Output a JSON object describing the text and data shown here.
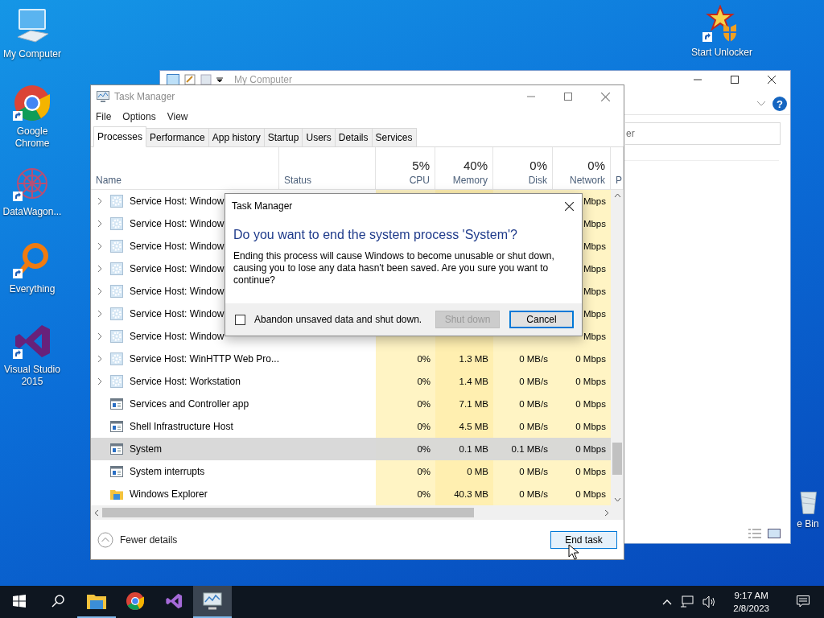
{
  "desktop_icons": [
    {
      "label": "My Computer",
      "kind": "computer",
      "shortcut": false
    },
    {
      "label": "Google Chrome",
      "kind": "chrome",
      "shortcut": true
    },
    {
      "label": "DataWagon...",
      "kind": "mandala",
      "shortcut": true
    },
    {
      "label": "Everything",
      "kind": "magnifier",
      "shortcut": true
    },
    {
      "label": "Visual Studio 2015",
      "kind": "vs",
      "shortcut": true
    },
    {
      "label": "Start Unlocker",
      "kind": "wand",
      "shortcut": true
    },
    {
      "label": "e Bin",
      "kind": "bin",
      "shortcut": false
    }
  ],
  "explorer": {
    "title": "My Computer",
    "search_text": "er",
    "help": "?"
  },
  "task_manager": {
    "title": "Task Manager",
    "menu": [
      "File",
      "Options",
      "View"
    ],
    "tabs": [
      {
        "label": "Processes",
        "selected": true
      },
      {
        "label": "Performance",
        "selected": false
      },
      {
        "label": "App history",
        "selected": false
      },
      {
        "label": "Startup",
        "selected": false
      },
      {
        "label": "Users",
        "selected": false
      },
      {
        "label": "Details",
        "selected": false
      },
      {
        "label": "Services",
        "selected": false
      }
    ],
    "columns": [
      {
        "label": "Name"
      },
      {
        "label": "Status"
      },
      {
        "label": "CPU",
        "percent": "5%"
      },
      {
        "label": "Memory",
        "percent": "40%"
      },
      {
        "label": "Disk",
        "percent": "0%"
      },
      {
        "label": "Network",
        "percent": "0%"
      },
      {
        "label": "P"
      }
    ],
    "rows": [
      {
        "name": "Service Host: Window",
        "kind": "gear",
        "expandable": true,
        "selected": false,
        "network": "Mbps"
      },
      {
        "name": "Service Host: Window",
        "kind": "gear",
        "expandable": true,
        "selected": false,
        "network": "Mbps"
      },
      {
        "name": "Service Host: Window",
        "kind": "gear",
        "expandable": true,
        "selected": false,
        "network": "Mbps"
      },
      {
        "name": "Service Host: Window",
        "kind": "gear",
        "expandable": true,
        "selected": false,
        "network": "Mbps"
      },
      {
        "name": "Service Host: Window",
        "kind": "gear",
        "expandable": true,
        "selected": false,
        "network": "Mbps"
      },
      {
        "name": "Service Host: Window",
        "kind": "gear",
        "expandable": true,
        "selected": false,
        "network": "Mbps"
      },
      {
        "name": "Service Host: Window",
        "kind": "gear",
        "expandable": true,
        "selected": false,
        "network": "Mbps"
      },
      {
        "name": "Service Host: WinHTTP Web Pro...",
        "kind": "gear",
        "expandable": true,
        "selected": false,
        "cpu": "0%",
        "memory": "1.3 MB",
        "disk": "0 MB/s",
        "network": "0 Mbps"
      },
      {
        "name": "Service Host: Workstation",
        "kind": "gear",
        "expandable": true,
        "selected": false,
        "cpu": "0%",
        "memory": "1.4 MB",
        "disk": "0 MB/s",
        "network": "0 Mbps"
      },
      {
        "name": "Services and Controller app",
        "kind": "app",
        "expandable": false,
        "selected": false,
        "cpu": "0%",
        "memory": "7.1 MB",
        "disk": "0 MB/s",
        "network": "0 Mbps"
      },
      {
        "name": "Shell Infrastructure Host",
        "kind": "app",
        "expandable": false,
        "selected": false,
        "cpu": "0%",
        "memory": "4.5 MB",
        "disk": "0 MB/s",
        "network": "0 Mbps"
      },
      {
        "name": "System",
        "kind": "app",
        "expandable": false,
        "selected": true,
        "cpu": "0%",
        "memory": "0.1 MB",
        "disk": "0.1 MB/s",
        "network": "0 Mbps"
      },
      {
        "name": "System interrupts",
        "kind": "app",
        "expandable": false,
        "selected": false,
        "cpu": "0%",
        "memory": "0 MB",
        "disk": "0 MB/s",
        "network": "0 Mbps"
      },
      {
        "name": "Windows Explorer",
        "kind": "folder",
        "expandable": false,
        "selected": false,
        "cpu": "0%",
        "memory": "40.3 MB",
        "disk": "0 MB/s",
        "network": "0 Mbps"
      }
    ],
    "fewer_details": "Fewer details",
    "end_task": "End task"
  },
  "dialog": {
    "title": "Task Manager",
    "heading": "Do you want to end the system process 'System'?",
    "message": "Ending this process will cause Windows to become unusable or shut down, causing you to lose any data hasn't been saved. Are you sure you want to continue?",
    "checkbox": {
      "label": "Abandon unsaved data and shut down.",
      "checked": false
    },
    "buttons": [
      {
        "label": "Shut down",
        "disabled": true,
        "default": false
      },
      {
        "label": "Cancel",
        "disabled": false,
        "default": true
      }
    ]
  },
  "taskbar": {
    "apps": [
      {
        "kind": "folder",
        "running": true,
        "active": false
      },
      {
        "kind": "chrome",
        "running": false,
        "active": false
      },
      {
        "kind": "vs",
        "running": false,
        "active": false
      },
      {
        "kind": "monitor",
        "running": true,
        "active": true
      }
    ],
    "time": "9:17 AM",
    "date": "2/8/2023"
  }
}
